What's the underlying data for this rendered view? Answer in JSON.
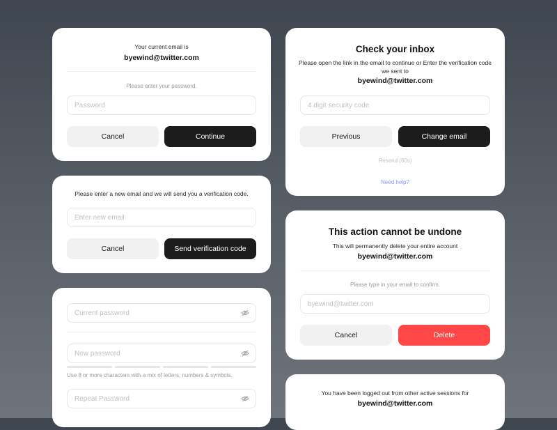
{
  "card_verify_password": {
    "current_email_label": "Your current email is",
    "email": "byewind@twitter.com",
    "prompt": "Please enter your password.",
    "password_placeholder": "Password",
    "cancel_label": "Cancel",
    "continue_label": "Continue"
  },
  "card_new_email": {
    "prompt": "Please enter a new email and we will send you a verification code.",
    "email_placeholder": "Enter new email",
    "cancel_label": "Cancel",
    "send_label": "Send verification code"
  },
  "card_change_password": {
    "current_placeholder": "Current password",
    "new_placeholder": "New password",
    "hint": "Use 8 or more characters with a mix of letters, numbers & symbols.",
    "repeat_placeholder": "Repeat Password",
    "strength_segments_filled": 0
  },
  "card_check_inbox": {
    "title": "Check your inbox",
    "description": "Please open the link in the email to continue or Enter the verification code we sent to",
    "email": "byewind@twitter.com",
    "code_placeholder": "4 digit security code",
    "previous_label": "Previous",
    "change_email_label": "Change email",
    "resend_label": "Resend (60s)",
    "help_label": "Need help?"
  },
  "card_delete": {
    "title": "This action cannot be undone",
    "description": "This will permanently delete your entire account",
    "email": "byewind@twitter.com",
    "prompt": "Please type in your email to confirm.",
    "confirm_placeholder": "byewind@twitter.com",
    "cancel_label": "Cancel",
    "delete_label": "Delete"
  },
  "card_logged_out": {
    "message": "You have been logged out from other active sessions for",
    "email": "byewind@twitter.com"
  },
  "colors": {
    "dark_button": "#1c1c1c",
    "delete_button": "#ff4747",
    "link": "#8a94ff"
  }
}
